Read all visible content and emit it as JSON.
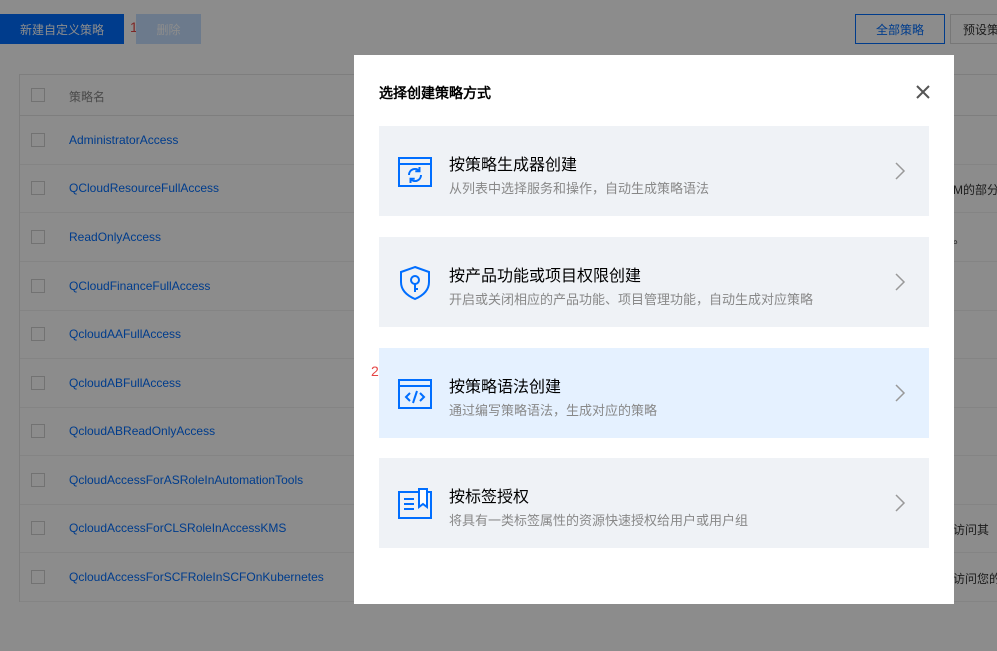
{
  "toolbar": {
    "create_label": "新建自定义策略",
    "delete_label": "删除",
    "marker_1": "1",
    "all_label": "全部策略",
    "preset_label": "预设策"
  },
  "table": {
    "header_name": "策略名",
    "rows": [
      {
        "name": "AdministratorAccess",
        "desc": ""
      },
      {
        "name": "QCloudResourceFullAccess",
        "desc": "M的部分"
      },
      {
        "name": "ReadOnlyAccess",
        "desc": "。"
      },
      {
        "name": "QCloudFinanceFullAccess",
        "desc": ""
      },
      {
        "name": "QcloudAAFullAccess",
        "desc": ""
      },
      {
        "name": "QcloudABFullAccess",
        "desc": ""
      },
      {
        "name": "QcloudABReadOnlyAccess",
        "desc": ""
      },
      {
        "name": "QcloudAccessForASRoleInAutomationTools",
        "desc": ""
      },
      {
        "name": "QcloudAccessForCLSRoleInAccessKMS",
        "desc": "访问其"
      },
      {
        "name": "QcloudAccessForSCFRoleInSCFOnKubernetes",
        "desc": "访问您的"
      }
    ]
  },
  "modal": {
    "title": "选择创建策略方式",
    "marker_2": "2",
    "options": [
      {
        "title": "按策略生成器创建",
        "subtitle": "从列表中选择服务和操作，自动生成策略语法",
        "icon": "refresh-window-icon"
      },
      {
        "title": "按产品功能或项目权限创建",
        "subtitle": "开启或关闭相应的产品功能、项目管理功能，自动生成对应策略",
        "icon": "shield-key-icon"
      },
      {
        "title": "按策略语法创建",
        "subtitle": "通过编写策略语法，生成对应的策略",
        "icon": "code-window-icon"
      },
      {
        "title": "按标签授权",
        "subtitle": "将具有一类标签属性的资源快速授权给用户或用户组",
        "icon": "tag-document-icon"
      }
    ]
  },
  "colors": {
    "accent": "#006eff",
    "marker": "#e54545",
    "option_bg": "#eff2f6",
    "option_active_bg": "#e5f1ff"
  }
}
